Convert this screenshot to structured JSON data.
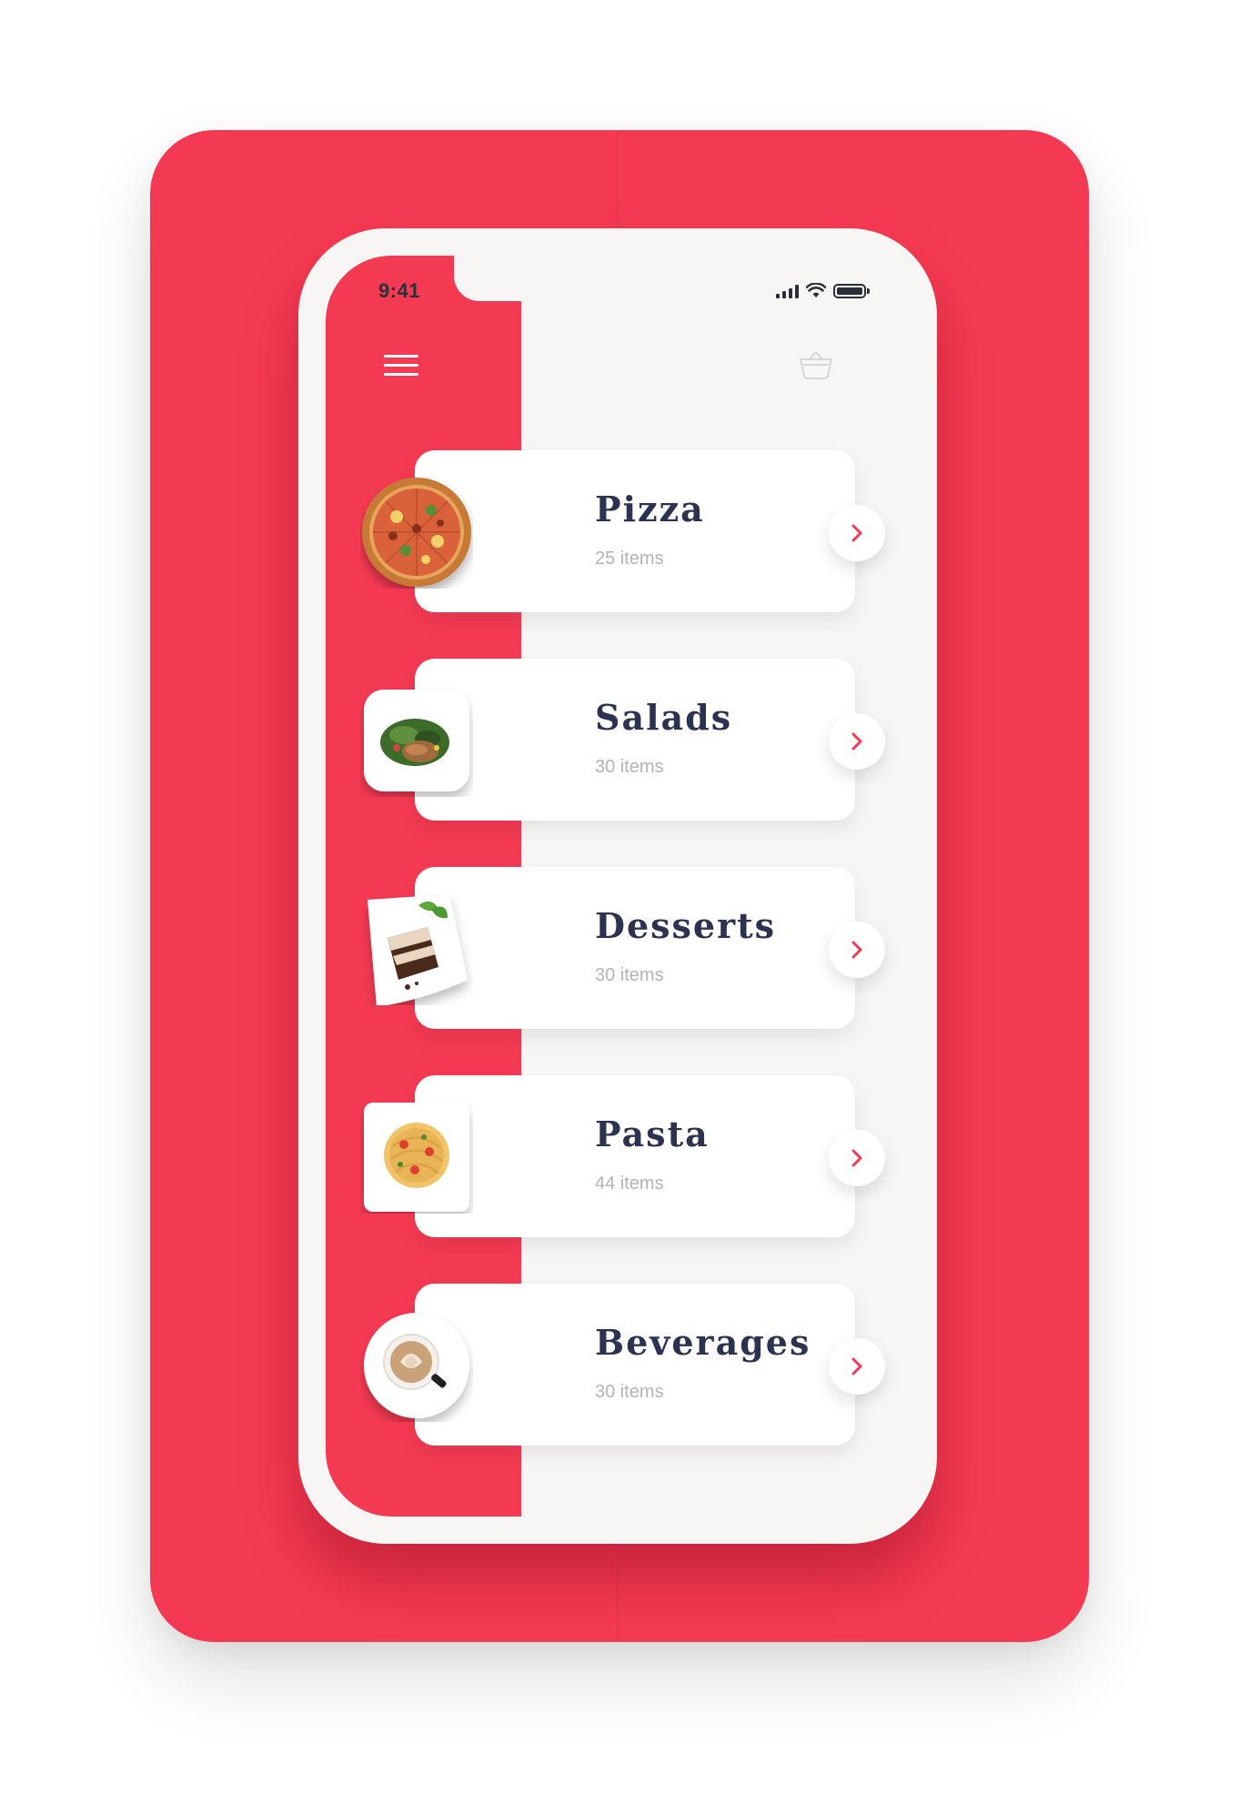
{
  "status_bar": {
    "time": "9:41",
    "icons": [
      "cellular-signal-icon",
      "wifi-icon",
      "battery-icon"
    ]
  },
  "header": {
    "menu_icon": "hamburger-menu-icon",
    "cart_icon": "basket-icon"
  },
  "categories": [
    {
      "title": "Pizza",
      "count": "25 items",
      "image": "pizza-image"
    },
    {
      "title": "Salads",
      "count": "30 items",
      "image": "salad-plate-image"
    },
    {
      "title": "Desserts",
      "count": "30 items",
      "image": "cake-slice-image"
    },
    {
      "title": "Pasta",
      "count": "44 items",
      "image": "pasta-plate-image"
    },
    {
      "title": "Beverages",
      "count": "30 items",
      "image": "coffee-cup-image"
    }
  ],
  "colors": {
    "accent": "#f43a52",
    "screen_bg": "#f7f6f5",
    "title": "#2b3350",
    "muted": "#b4b4b8",
    "card": "#ffffff"
  }
}
